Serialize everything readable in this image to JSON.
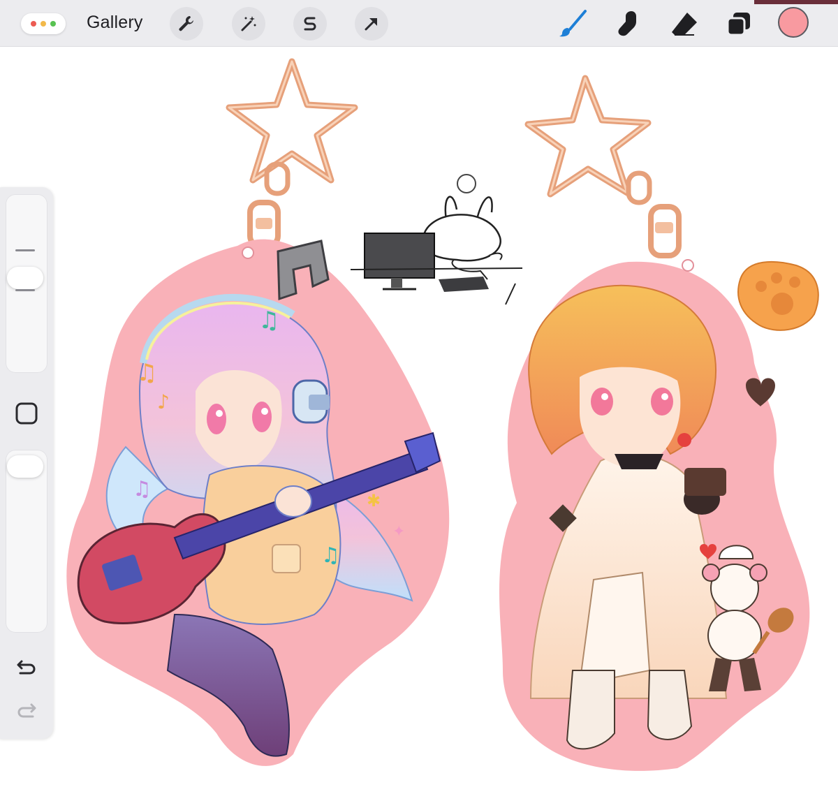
{
  "toolbar": {
    "gallery_label": "Gallery",
    "left_tools": [
      "wrench-icon",
      "magic-wand-icon",
      "selection-s-icon",
      "transform-arrow-icon"
    ],
    "right_tools": [
      "brush-icon",
      "smudge-icon",
      "eraser-icon",
      "layers-icon"
    ],
    "active_tool": "brush-icon",
    "current_color": "#f89aa0",
    "accent_color": "#1e7fd6"
  },
  "sidebar": {
    "controls": [
      "brush-size-slider",
      "modify-square-button",
      "opacity-slider",
      "undo-icon",
      "redo-icon"
    ]
  },
  "canvas": {
    "content": [
      "keychain-left-guitarist",
      "keychain-right-chef",
      "bunny-at-computer-doodle"
    ]
  }
}
